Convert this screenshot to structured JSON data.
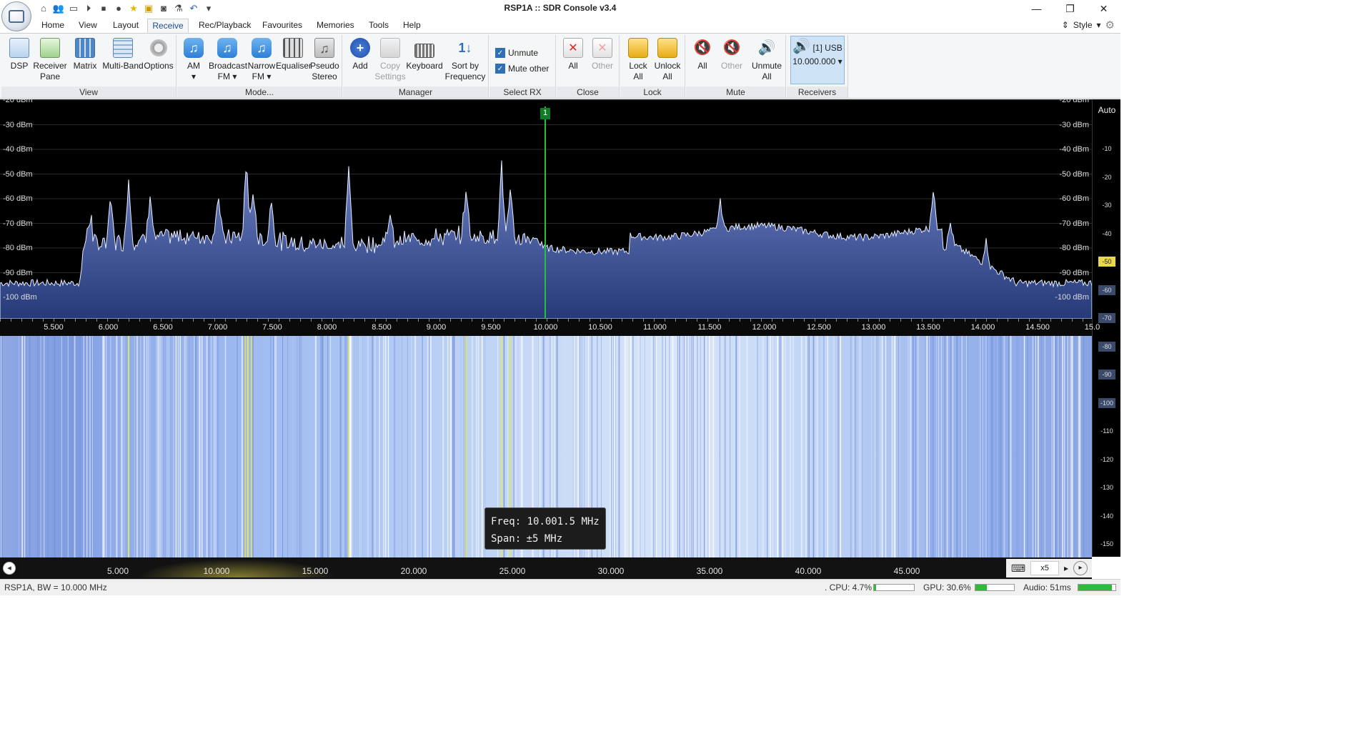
{
  "window": {
    "title": "RSP1A :: SDR Console v3.4",
    "minimize": "—",
    "restore": "❐",
    "close": "✕"
  },
  "qat": [
    "home-icon",
    "users-icon",
    "folder-icon",
    "play-icon",
    "stop-icon",
    "record-icon",
    "star-icon",
    "lock-icon",
    "camera-icon",
    "flask-icon",
    "undo-icon",
    "dropdown-icon"
  ],
  "menu": {
    "tabs": [
      "Home",
      "View",
      "Layout",
      "Receive",
      "Rec/Playback",
      "Favourites",
      "Memories",
      "Tools",
      "Help"
    ],
    "active": "Receive",
    "style_label": "Style"
  },
  "ribbon": {
    "groups": [
      "View",
      "Mode...",
      "Manager",
      "Select RX",
      "Close",
      "Lock",
      "Mute",
      "Receivers"
    ],
    "view": [
      {
        "label": "DSP"
      },
      {
        "label": "Receiver",
        "label2": "Pane"
      },
      {
        "label": "Matrix"
      },
      {
        "label": "Multi-Band"
      },
      {
        "label": "Options"
      }
    ],
    "mode": [
      {
        "label": "AM",
        "label2": "▾"
      },
      {
        "label": "Broadcast",
        "label2": "FM ▾"
      },
      {
        "label": "Narrow",
        "label2": "FM ▾"
      },
      {
        "label": "Equaliser"
      },
      {
        "label": "Pseudo",
        "label2": "Stereo"
      }
    ],
    "manager": [
      {
        "label": "Add"
      },
      {
        "label": "Copy",
        "label2": "Settings"
      },
      {
        "label": "Keyboard"
      },
      {
        "label": "Sort by",
        "label2": "Frequency"
      }
    ],
    "select_rx": {
      "unmute": "Unmute",
      "mute_other": "Mute other",
      "unmute_checked": true,
      "mute_other_checked": true
    },
    "close": [
      {
        "label": "All"
      },
      {
        "label": "Other"
      }
    ],
    "lock": [
      {
        "label": "Lock",
        "label2": "All"
      },
      {
        "label": "Unlock",
        "label2": "All"
      }
    ],
    "mute": [
      {
        "label": "All"
      },
      {
        "label": "Other"
      },
      {
        "label": "Unmute",
        "label2": "All"
      }
    ],
    "receivers": {
      "line1": "[1]  USB",
      "line2": "10.000.000 ▾"
    }
  },
  "spectrum": {
    "db_labels": [
      "-20 dBm",
      "-30 dBm",
      "-40 dBm",
      "-50 dBm",
      "-60 dBm",
      "-70 dBm",
      "-80 dBm",
      "-90 dBm",
      "-100 dBm"
    ],
    "marker_label": "1",
    "freq_labels": [
      "5.500",
      "6.000",
      "6.500",
      "7.000",
      "7.500",
      "8.000",
      "8.500",
      "9.000",
      "9.500",
      "10.000",
      "10.500",
      "11.000",
      "11.500",
      "12.000",
      "12.500",
      "13.000",
      "13.500",
      "14.000",
      "14.500",
      "15.0"
    ]
  },
  "colorbar": {
    "auto_label": "Auto",
    "ticks": [
      "-10",
      "-20",
      "-30",
      "-40",
      "-50",
      "-60",
      "-70",
      "-80",
      "-90",
      "-100",
      "-110",
      "-120",
      "-130",
      "-140",
      "-150"
    ],
    "highlight": "-50"
  },
  "tooltip": {
    "freq_label": "Freq:",
    "freq_value": "10.001.5 MHz",
    "span_label": "Span:",
    "span_value": "±5 MHz"
  },
  "bottom_scale": {
    "labels": [
      "5.000",
      "10.000",
      "15.000",
      "20.000",
      "25.000",
      "30.000",
      "35.000",
      "40.000",
      "45.000"
    ],
    "zoom": "x5"
  },
  "status": {
    "device": "RSP1A, BW = 10.000 MHz",
    "cpu": ". CPU: 4.7%",
    "gpu": "GPU: 30.6%",
    "audio": "Audio: 51ms",
    "cpu_level": 0.05,
    "gpu_level": 0.3,
    "audio_level": 0.9
  },
  "colors": {
    "accent": "#1a4f8b",
    "spectrum_fill": "#5b6fb0",
    "marker": "#22c23a",
    "meter": "#2dbb3c"
  }
}
